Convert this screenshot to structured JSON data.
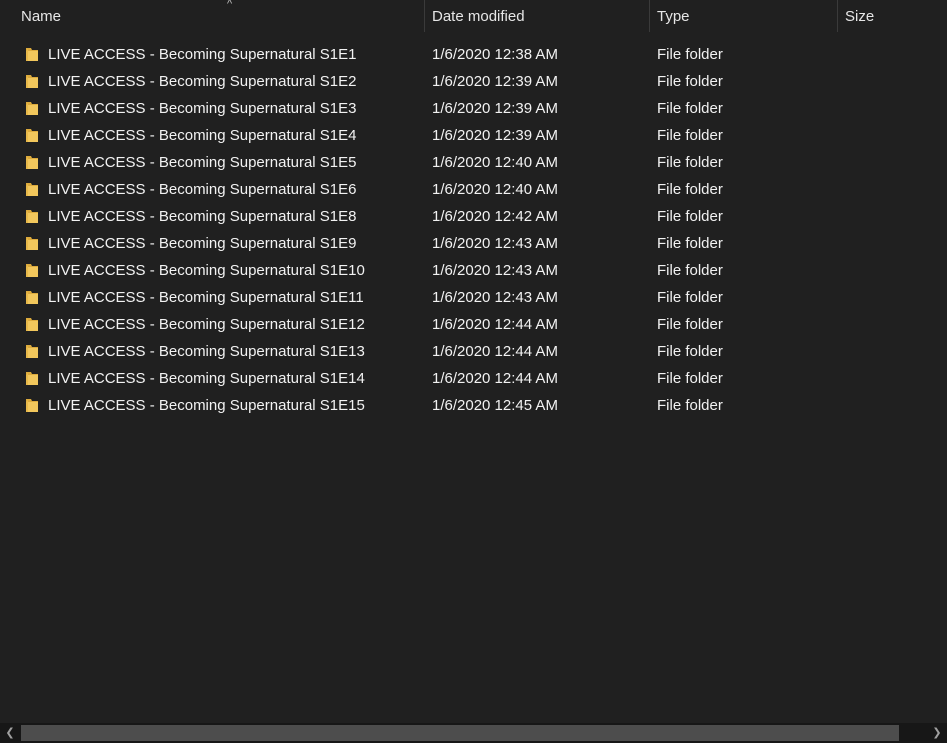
{
  "columns": {
    "name": "Name",
    "date": "Date modified",
    "type": "Type",
    "size": "Size"
  },
  "sort_glyph": "^",
  "rows": [
    {
      "name": "LIVE ACCESS - Becoming Supernatural S1E1",
      "date": "1/6/2020 12:38 AM",
      "type": "File folder"
    },
    {
      "name": "LIVE ACCESS - Becoming Supernatural S1E2",
      "date": "1/6/2020 12:39 AM",
      "type": "File folder"
    },
    {
      "name": "LIVE ACCESS - Becoming Supernatural S1E3",
      "date": "1/6/2020 12:39 AM",
      "type": "File folder"
    },
    {
      "name": "LIVE ACCESS - Becoming Supernatural S1E4",
      "date": "1/6/2020 12:39 AM",
      "type": "File folder"
    },
    {
      "name": "LIVE ACCESS - Becoming Supernatural S1E5",
      "date": "1/6/2020 12:40 AM",
      "type": "File folder"
    },
    {
      "name": "LIVE ACCESS - Becoming Supernatural S1E6",
      "date": "1/6/2020 12:40 AM",
      "type": "File folder"
    },
    {
      "name": "LIVE ACCESS - Becoming Supernatural S1E8",
      "date": "1/6/2020 12:42 AM",
      "type": "File folder"
    },
    {
      "name": "LIVE ACCESS - Becoming Supernatural S1E9",
      "date": "1/6/2020 12:43 AM",
      "type": "File folder"
    },
    {
      "name": "LIVE ACCESS - Becoming Supernatural S1E10",
      "date": "1/6/2020 12:43 AM",
      "type": "File folder"
    },
    {
      "name": "LIVE ACCESS - Becoming Supernatural S1E11",
      "date": "1/6/2020 12:43 AM",
      "type": "File folder"
    },
    {
      "name": "LIVE ACCESS - Becoming Supernatural S1E12",
      "date": "1/6/2020 12:44 AM",
      "type": "File folder"
    },
    {
      "name": "LIVE ACCESS - Becoming Supernatural S1E13",
      "date": "1/6/2020 12:44 AM",
      "type": "File folder"
    },
    {
      "name": "LIVE ACCESS - Becoming Supernatural S1E14",
      "date": "1/6/2020 12:44 AM",
      "type": "File folder"
    },
    {
      "name": "LIVE ACCESS - Becoming Supernatural S1E15",
      "date": "1/6/2020 12:45 AM",
      "type": "File folder"
    }
  ],
  "icons": {
    "row": "folder-icon",
    "scroll_left": "chevron-left-icon",
    "scroll_right": "chevron-right-icon"
  },
  "colors": {
    "background": "#202020",
    "text": "#f2f2f2",
    "folder_front": "#f2c75c",
    "folder_back": "#dcaa3c",
    "scroll_thumb": "#4d4d4d"
  }
}
